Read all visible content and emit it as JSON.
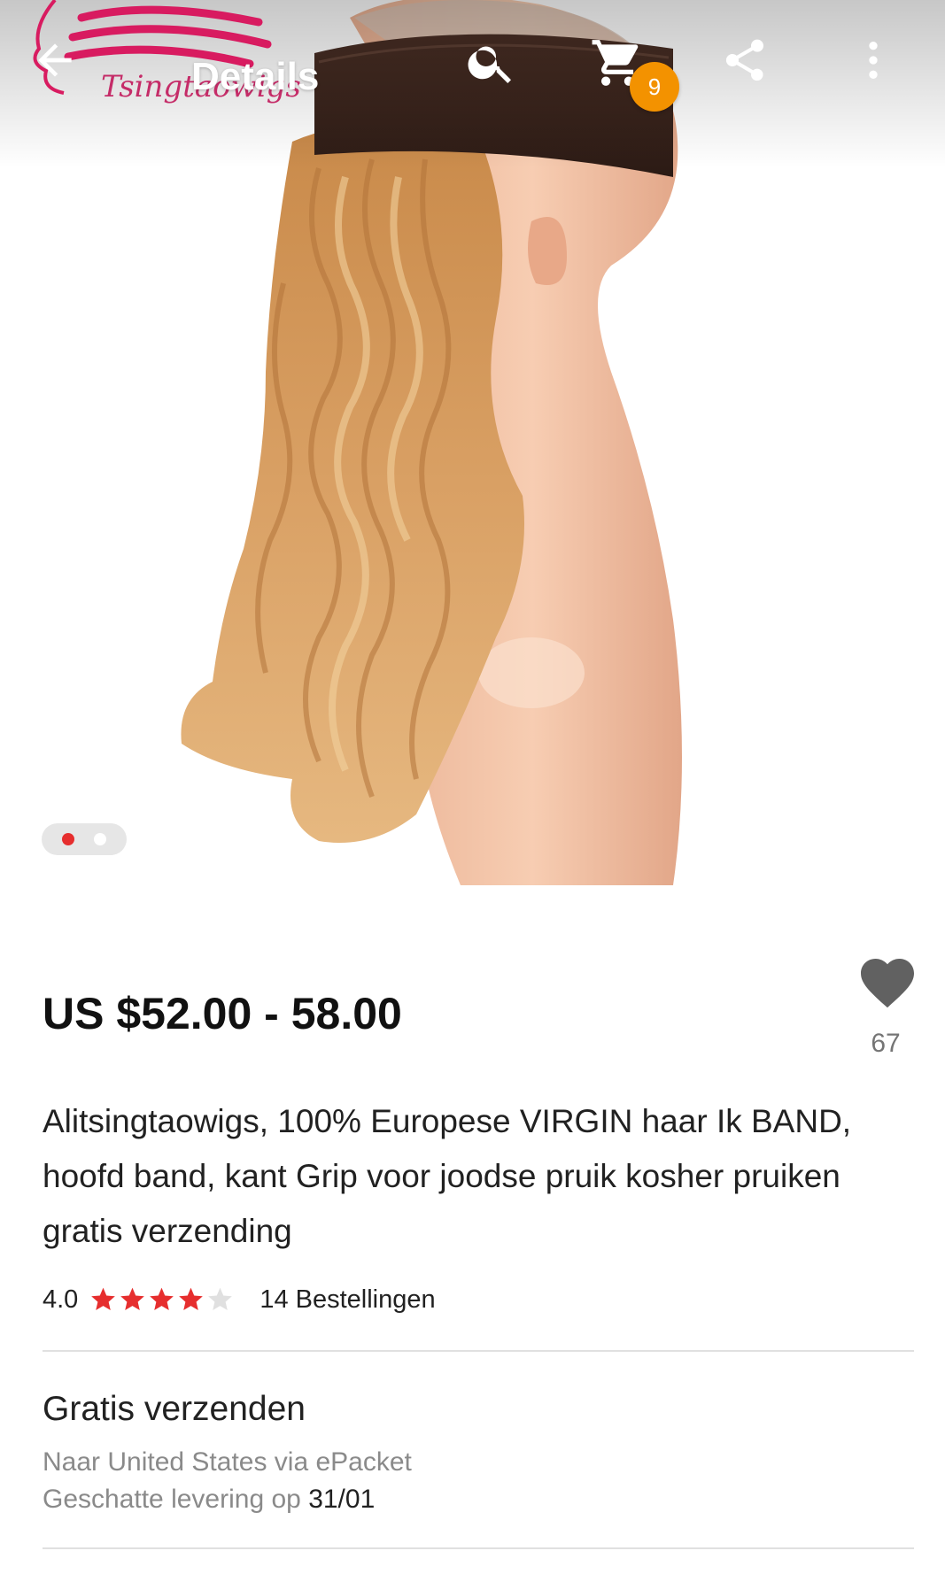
{
  "toolbar": {
    "title": "Details",
    "cart_count": "9"
  },
  "logo": {
    "text": "Tsingtaowigs"
  },
  "gallery": {
    "total": 2,
    "active_index": 0
  },
  "product": {
    "price": "US $52.00 - 58.00",
    "wishlist_count": "67",
    "title": "Alitsingtaowigs, 100% Europese VIRGIN haar Ik BAND, hoofd band, kant Grip voor joodse pruik kosher pruiken gratis verzending",
    "rating": "4.0",
    "rating_stars": 4,
    "rating_max": 5,
    "orders": "14 Bestellingen"
  },
  "shipping": {
    "title": "Gratis verzenden",
    "route": "Naar United States via ePacket",
    "delivery_label": "Geschatte levering op",
    "delivery_date": "31/01"
  },
  "colors": {
    "accent": "#e62e2e",
    "badge": "#f39200",
    "star": "#e62e2e",
    "star_empty": "#e0e0e0"
  },
  "icons": [
    "back-arrow-icon",
    "search-icon",
    "cart-icon",
    "share-icon",
    "more-vertical-icon",
    "heart-icon",
    "star-icon"
  ]
}
